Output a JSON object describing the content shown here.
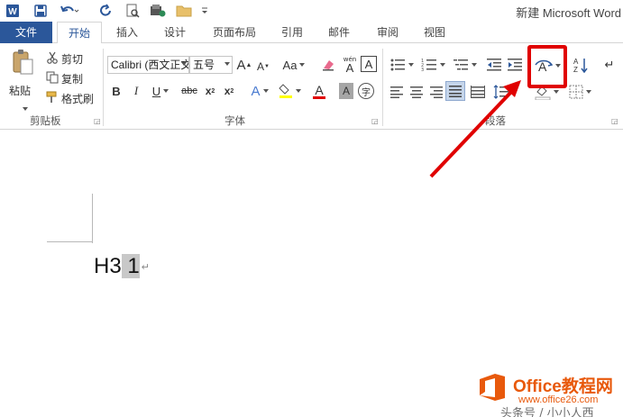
{
  "window": {
    "title": "新建 Microsoft Word"
  },
  "quick_access": {
    "icons": [
      "word-logo-icon",
      "save-icon",
      "undo-icon",
      "redo-icon",
      "print-preview-icon",
      "email-icon",
      "folder-icon",
      "customize-icon"
    ]
  },
  "tabs": [
    {
      "label": "文件",
      "type": "file"
    },
    {
      "label": "开始",
      "type": "active"
    },
    {
      "label": "插入"
    },
    {
      "label": "设计"
    },
    {
      "label": "页面布局"
    },
    {
      "label": "引用"
    },
    {
      "label": "邮件"
    },
    {
      "label": "审阅"
    },
    {
      "label": "视图"
    }
  ],
  "ribbon": {
    "clipboard": {
      "label": "剪贴板",
      "paste": "粘贴",
      "cut": "剪切",
      "copy": "复制",
      "format_painter": "格式刷"
    },
    "font": {
      "label": "字体",
      "font_name": "Calibri (西文正文)",
      "font_size": "五号",
      "grow": "A",
      "shrink": "A",
      "change_case": "Aa",
      "phonetic": "wén",
      "phonetic_char": "A",
      "border_char": "A",
      "bold": "B",
      "italic": "I",
      "underline": "U",
      "strike": "abc",
      "subscript": "x",
      "subscript_mark": "2",
      "superscript": "x",
      "superscript_mark": "2",
      "text_effect": "A",
      "font_color": "A",
      "char_shading": "A",
      "enclose": "字"
    },
    "paragraph": {
      "label": "段落",
      "sort": "A↓Z"
    }
  },
  "document": {
    "text_before": "H3",
    "text_selected": " 1",
    "para_mark": "↵"
  },
  "watermark": {
    "brand": "Office教程网",
    "url": "www.office26.com",
    "subtitle": "头条号 / 小小人西"
  },
  "colors": {
    "file_tab": "#2b579a",
    "highlight_box": "#e00000",
    "watermark": "#e8590c",
    "font_color_bar": "#e00000",
    "highlight_color_bar": "#ffff00"
  }
}
